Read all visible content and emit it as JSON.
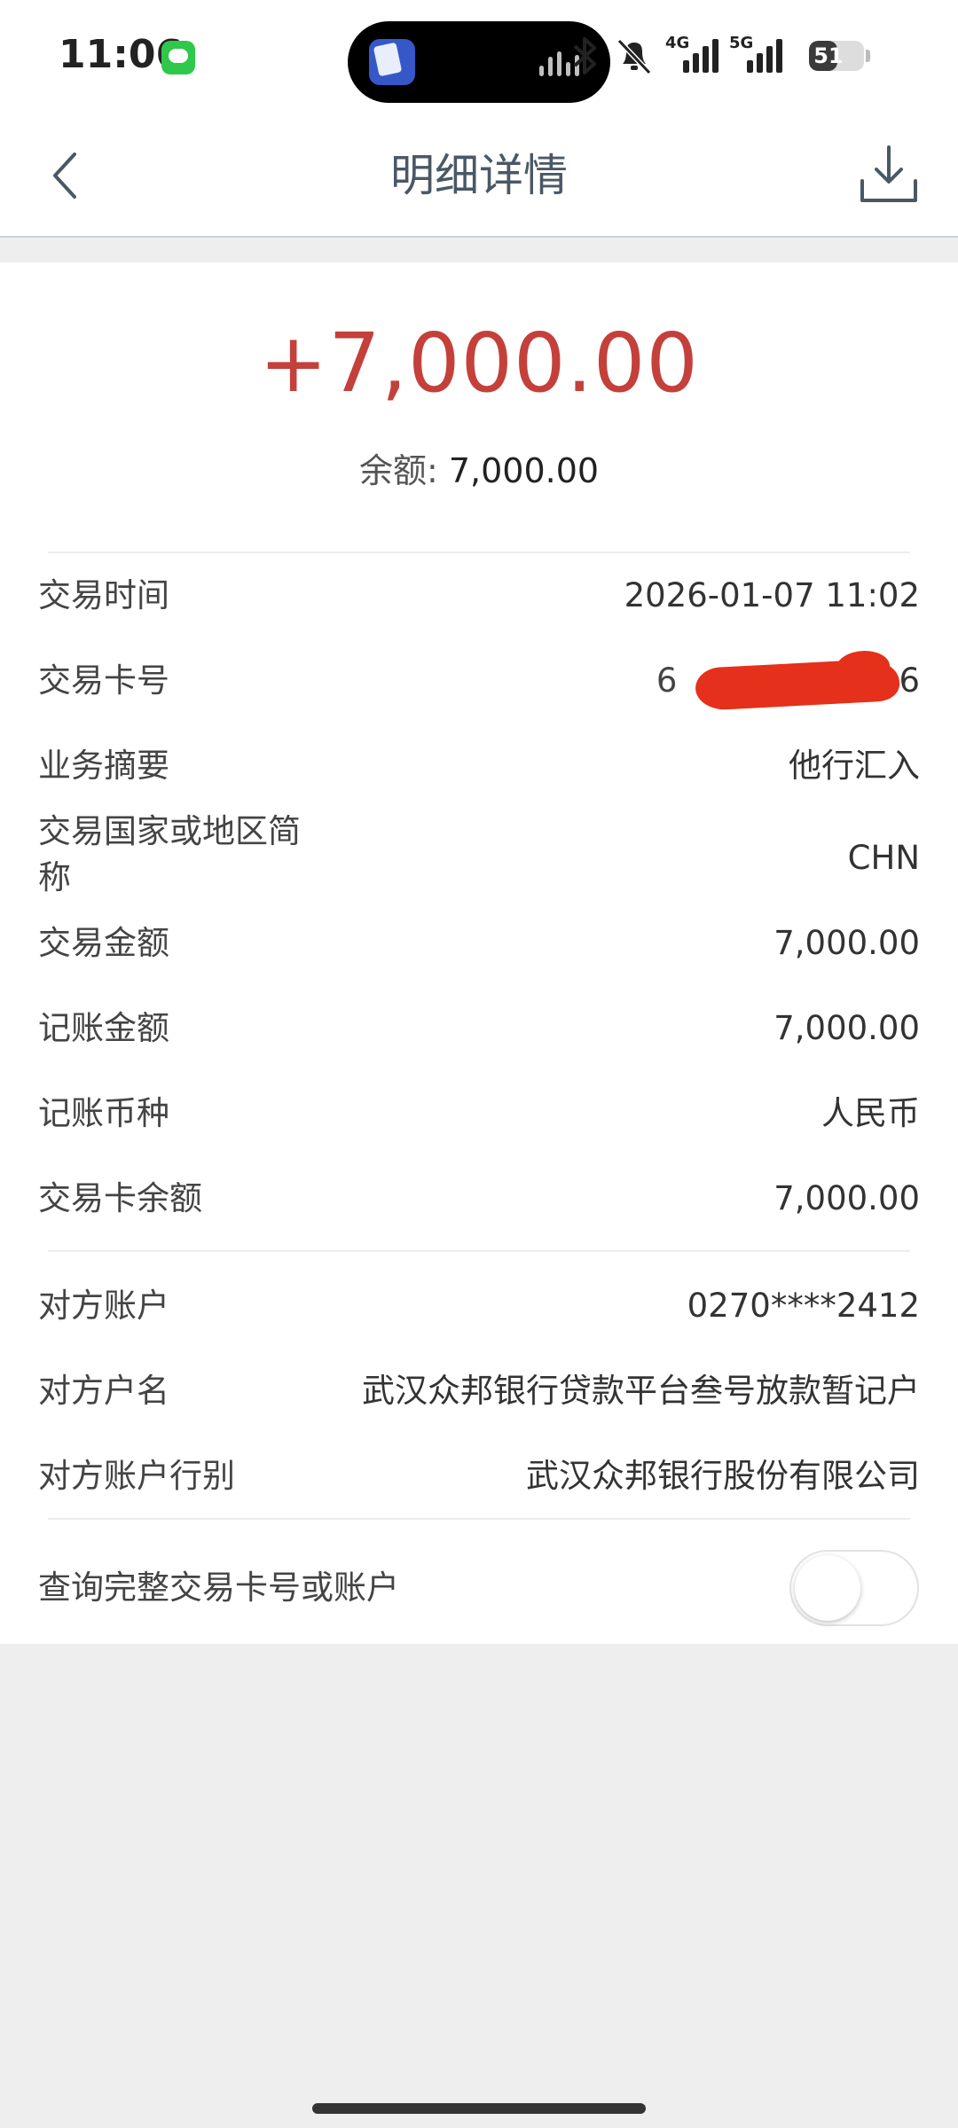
{
  "status_bar": {
    "time": "11:06",
    "battery_level": "51",
    "network_1": "4G",
    "network_2": "5G"
  },
  "header": {
    "title": "明细详情"
  },
  "summary": {
    "amount": "+7,000.00",
    "balance_label": "余额: ",
    "balance_value": "7,000.00"
  },
  "details": {
    "transaction_time": {
      "label": "交易时间",
      "value": "2026-01-07 11:02"
    },
    "card_number": {
      "label": "交易卡号",
      "value_start": "6",
      "value_end": "6"
    },
    "summary": {
      "label": "业务摘要",
      "value": "他行汇入"
    },
    "country": {
      "label": "交易国家或地区简称",
      "value": "CHN"
    },
    "transaction_amount": {
      "label": "交易金额",
      "value": "7,000.00"
    },
    "posted_amount": {
      "label": "记账金额",
      "value": "7,000.00"
    },
    "posted_currency": {
      "label": "记账币种",
      "value": "人民币"
    },
    "card_balance": {
      "label": "交易卡余额",
      "value": "7,000.00"
    }
  },
  "counterparty": {
    "account": {
      "label": "对方账户",
      "value": "0270****2412"
    },
    "name": {
      "label": "对方户名",
      "value": "武汉众邦银行贷款平台叁号放款暂记户"
    },
    "bank": {
      "label": "对方账户行别",
      "value": "武汉众邦银行股份有限公司"
    }
  },
  "full_number_toggle": {
    "label": "查询完整交易卡号或账户",
    "state": "off"
  },
  "colors": {
    "amount": "#c4403a",
    "redaction": "#e5301b",
    "title": "#4a5866"
  }
}
